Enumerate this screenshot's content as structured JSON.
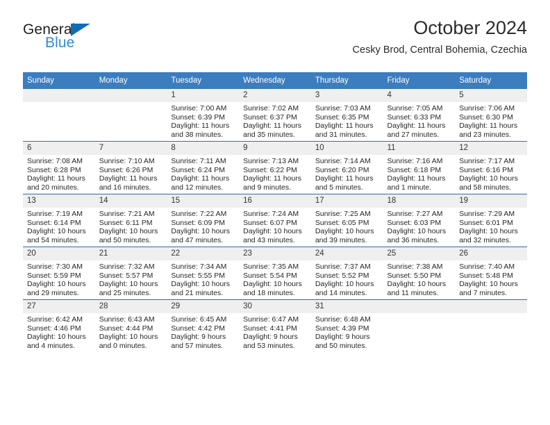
{
  "brand": {
    "name_dark": "General",
    "name_blue": "Blue",
    "accent_dark_blue": "#0f6cb5",
    "accent_light_blue": "#2e8bd8"
  },
  "header": {
    "title": "October 2024",
    "subtitle": "Cesky Brod, Central Bohemia, Czechia"
  },
  "theme": {
    "header_row_bg": "#3b7dbf",
    "daynum_bg": "#efefef",
    "row_border": "#2e6ead"
  },
  "weekday_headers": [
    "Sunday",
    "Monday",
    "Tuesday",
    "Wednesday",
    "Thursday",
    "Friday",
    "Saturday"
  ],
  "weeks": [
    [
      {
        "day": "",
        "sunrise": "",
        "sunset": "",
        "daylight1": "",
        "daylight2": ""
      },
      {
        "day": "",
        "sunrise": "",
        "sunset": "",
        "daylight1": "",
        "daylight2": ""
      },
      {
        "day": "1",
        "sunrise": "Sunrise: 7:00 AM",
        "sunset": "Sunset: 6:39 PM",
        "daylight1": "Daylight: 11 hours",
        "daylight2": "and 38 minutes."
      },
      {
        "day": "2",
        "sunrise": "Sunrise: 7:02 AM",
        "sunset": "Sunset: 6:37 PM",
        "daylight1": "Daylight: 11 hours",
        "daylight2": "and 35 minutes."
      },
      {
        "day": "3",
        "sunrise": "Sunrise: 7:03 AM",
        "sunset": "Sunset: 6:35 PM",
        "daylight1": "Daylight: 11 hours",
        "daylight2": "and 31 minutes."
      },
      {
        "day": "4",
        "sunrise": "Sunrise: 7:05 AM",
        "sunset": "Sunset: 6:33 PM",
        "daylight1": "Daylight: 11 hours",
        "daylight2": "and 27 minutes."
      },
      {
        "day": "5",
        "sunrise": "Sunrise: 7:06 AM",
        "sunset": "Sunset: 6:30 PM",
        "daylight1": "Daylight: 11 hours",
        "daylight2": "and 23 minutes."
      }
    ],
    [
      {
        "day": "6",
        "sunrise": "Sunrise: 7:08 AM",
        "sunset": "Sunset: 6:28 PM",
        "daylight1": "Daylight: 11 hours",
        "daylight2": "and 20 minutes."
      },
      {
        "day": "7",
        "sunrise": "Sunrise: 7:10 AM",
        "sunset": "Sunset: 6:26 PM",
        "daylight1": "Daylight: 11 hours",
        "daylight2": "and 16 minutes."
      },
      {
        "day": "8",
        "sunrise": "Sunrise: 7:11 AM",
        "sunset": "Sunset: 6:24 PM",
        "daylight1": "Daylight: 11 hours",
        "daylight2": "and 12 minutes."
      },
      {
        "day": "9",
        "sunrise": "Sunrise: 7:13 AM",
        "sunset": "Sunset: 6:22 PM",
        "daylight1": "Daylight: 11 hours",
        "daylight2": "and 9 minutes."
      },
      {
        "day": "10",
        "sunrise": "Sunrise: 7:14 AM",
        "sunset": "Sunset: 6:20 PM",
        "daylight1": "Daylight: 11 hours",
        "daylight2": "and 5 minutes."
      },
      {
        "day": "11",
        "sunrise": "Sunrise: 7:16 AM",
        "sunset": "Sunset: 6:18 PM",
        "daylight1": "Daylight: 11 hours",
        "daylight2": "and 1 minute."
      },
      {
        "day": "12",
        "sunrise": "Sunrise: 7:17 AM",
        "sunset": "Sunset: 6:16 PM",
        "daylight1": "Daylight: 10 hours",
        "daylight2": "and 58 minutes."
      }
    ],
    [
      {
        "day": "13",
        "sunrise": "Sunrise: 7:19 AM",
        "sunset": "Sunset: 6:14 PM",
        "daylight1": "Daylight: 10 hours",
        "daylight2": "and 54 minutes."
      },
      {
        "day": "14",
        "sunrise": "Sunrise: 7:21 AM",
        "sunset": "Sunset: 6:11 PM",
        "daylight1": "Daylight: 10 hours",
        "daylight2": "and 50 minutes."
      },
      {
        "day": "15",
        "sunrise": "Sunrise: 7:22 AM",
        "sunset": "Sunset: 6:09 PM",
        "daylight1": "Daylight: 10 hours",
        "daylight2": "and 47 minutes."
      },
      {
        "day": "16",
        "sunrise": "Sunrise: 7:24 AM",
        "sunset": "Sunset: 6:07 PM",
        "daylight1": "Daylight: 10 hours",
        "daylight2": "and 43 minutes."
      },
      {
        "day": "17",
        "sunrise": "Sunrise: 7:25 AM",
        "sunset": "Sunset: 6:05 PM",
        "daylight1": "Daylight: 10 hours",
        "daylight2": "and 39 minutes."
      },
      {
        "day": "18",
        "sunrise": "Sunrise: 7:27 AM",
        "sunset": "Sunset: 6:03 PM",
        "daylight1": "Daylight: 10 hours",
        "daylight2": "and 36 minutes."
      },
      {
        "day": "19",
        "sunrise": "Sunrise: 7:29 AM",
        "sunset": "Sunset: 6:01 PM",
        "daylight1": "Daylight: 10 hours",
        "daylight2": "and 32 minutes."
      }
    ],
    [
      {
        "day": "20",
        "sunrise": "Sunrise: 7:30 AM",
        "sunset": "Sunset: 5:59 PM",
        "daylight1": "Daylight: 10 hours",
        "daylight2": "and 29 minutes."
      },
      {
        "day": "21",
        "sunrise": "Sunrise: 7:32 AM",
        "sunset": "Sunset: 5:57 PM",
        "daylight1": "Daylight: 10 hours",
        "daylight2": "and 25 minutes."
      },
      {
        "day": "22",
        "sunrise": "Sunrise: 7:34 AM",
        "sunset": "Sunset: 5:55 PM",
        "daylight1": "Daylight: 10 hours",
        "daylight2": "and 21 minutes."
      },
      {
        "day": "23",
        "sunrise": "Sunrise: 7:35 AM",
        "sunset": "Sunset: 5:54 PM",
        "daylight1": "Daylight: 10 hours",
        "daylight2": "and 18 minutes."
      },
      {
        "day": "24",
        "sunrise": "Sunrise: 7:37 AM",
        "sunset": "Sunset: 5:52 PM",
        "daylight1": "Daylight: 10 hours",
        "daylight2": "and 14 minutes."
      },
      {
        "day": "25",
        "sunrise": "Sunrise: 7:38 AM",
        "sunset": "Sunset: 5:50 PM",
        "daylight1": "Daylight: 10 hours",
        "daylight2": "and 11 minutes."
      },
      {
        "day": "26",
        "sunrise": "Sunrise: 7:40 AM",
        "sunset": "Sunset: 5:48 PM",
        "daylight1": "Daylight: 10 hours",
        "daylight2": "and 7 minutes."
      }
    ],
    [
      {
        "day": "27",
        "sunrise": "Sunrise: 6:42 AM",
        "sunset": "Sunset: 4:46 PM",
        "daylight1": "Daylight: 10 hours",
        "daylight2": "and 4 minutes."
      },
      {
        "day": "28",
        "sunrise": "Sunrise: 6:43 AM",
        "sunset": "Sunset: 4:44 PM",
        "daylight1": "Daylight: 10 hours",
        "daylight2": "and 0 minutes."
      },
      {
        "day": "29",
        "sunrise": "Sunrise: 6:45 AM",
        "sunset": "Sunset: 4:42 PM",
        "daylight1": "Daylight: 9 hours",
        "daylight2": "and 57 minutes."
      },
      {
        "day": "30",
        "sunrise": "Sunrise: 6:47 AM",
        "sunset": "Sunset: 4:41 PM",
        "daylight1": "Daylight: 9 hours",
        "daylight2": "and 53 minutes."
      },
      {
        "day": "31",
        "sunrise": "Sunrise: 6:48 AM",
        "sunset": "Sunset: 4:39 PM",
        "daylight1": "Daylight: 9 hours",
        "daylight2": "and 50 minutes."
      },
      {
        "day": "",
        "sunrise": "",
        "sunset": "",
        "daylight1": "",
        "daylight2": ""
      },
      {
        "day": "",
        "sunrise": "",
        "sunset": "",
        "daylight1": "",
        "daylight2": ""
      }
    ]
  ]
}
